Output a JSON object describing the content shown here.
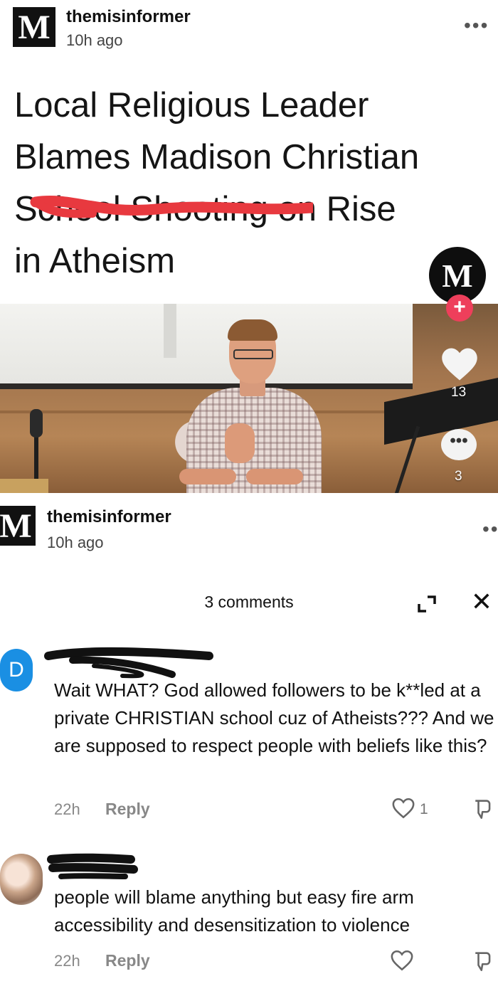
{
  "post": {
    "logo_letter": "M",
    "username": "themisinformer",
    "time": "10h ago",
    "more": "•••",
    "headline": {
      "line1": "Local Religious Leader",
      "line2": "Blames Madison Christian",
      "line3_struck": "School Shooting",
      "line3_rest": " on Rise",
      "line4": "in Atheism"
    }
  },
  "rail": {
    "avatar_letter": "M",
    "plus": "+",
    "likes": "13",
    "comments": "3",
    "comment_glyph": "•••"
  },
  "post2": {
    "logo_letter": "M",
    "username": "themisinformer",
    "time": "10h ago",
    "more": "••"
  },
  "comments_panel": {
    "title": "3 comments",
    "close": "✕"
  },
  "comments": [
    {
      "avatar_letter": "D",
      "text": "Wait WHAT? God allowed followers to be k**led at a private CHRISTIAN school cuz of Atheists??? And we are supposed to respect people with beliefs like this?",
      "time": "22h",
      "reply": "Reply",
      "likes": "1"
    },
    {
      "text": "people will blame anything but easy fire arm accessibility and desensitization to violence",
      "time": "22h",
      "reply": "Reply"
    }
  ],
  "colors": {
    "accent_red": "#ee3f5b",
    "avatar_blue": "#1a8fe3",
    "strike_red": "#e8393f"
  }
}
